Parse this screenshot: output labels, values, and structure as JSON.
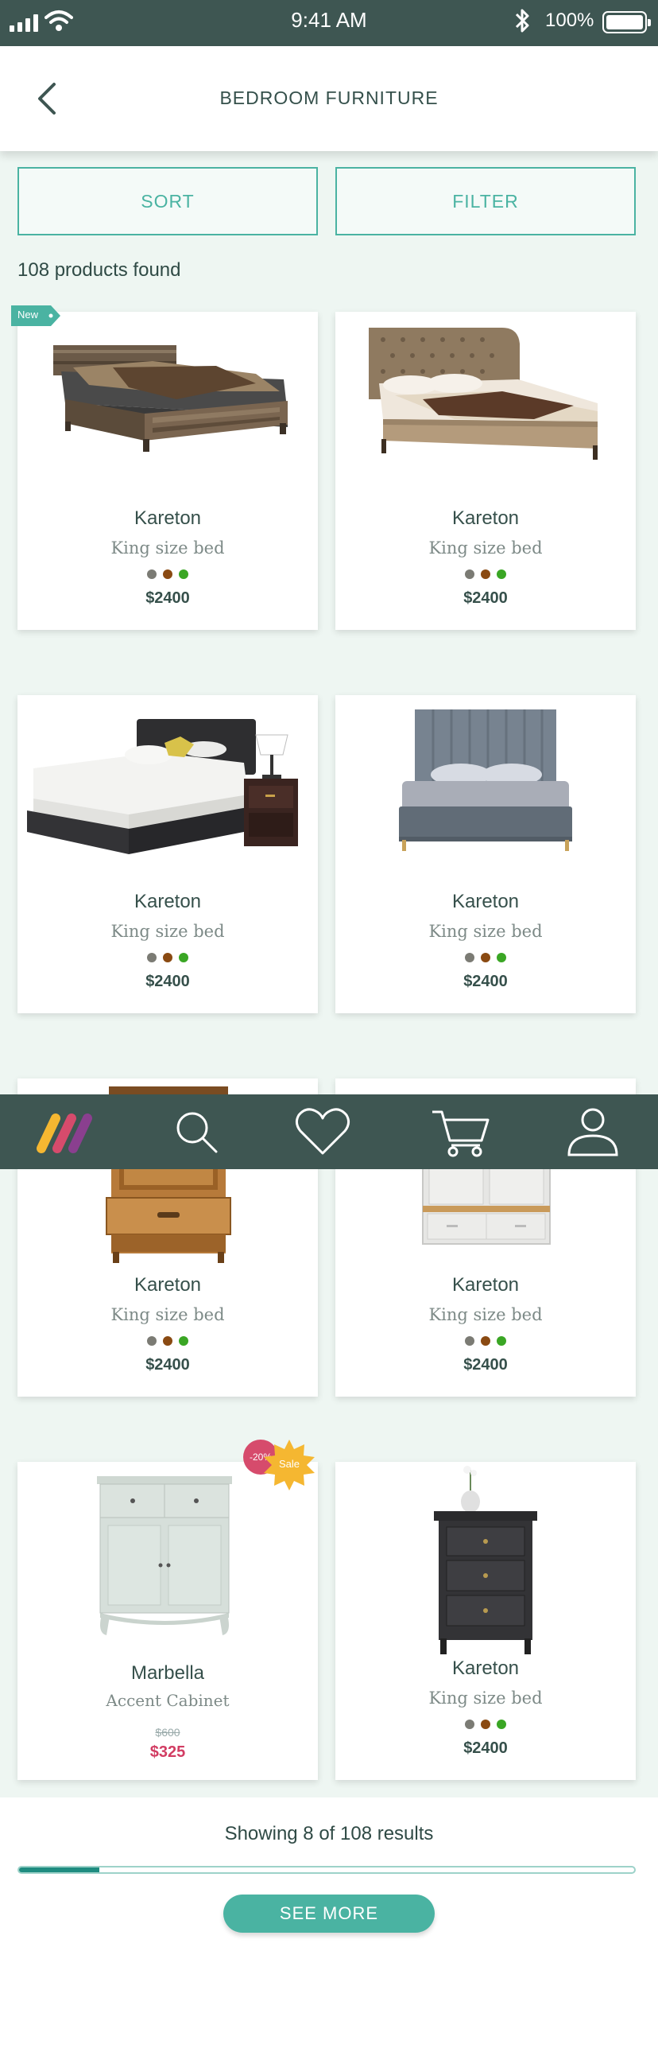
{
  "status_bar": {
    "time": "9:41 AM",
    "battery": "100%"
  },
  "header": {
    "title": "BEDROOM FURNITURE",
    "back_icon": "chevron-left-icon"
  },
  "controls": {
    "sort_label": "SORT",
    "filter_label": "FILTER"
  },
  "results": {
    "count_text": "108 products found",
    "showing_text": "Showing 8 of 108 results",
    "progress": 0.13,
    "see_more": "SEE MORE"
  },
  "colors": {
    "accent": "#4ab3a2",
    "nav_bg": "#3e5652",
    "sale": "#d23d63",
    "dot_gray": "#7b7b74",
    "dot_brown": "#8a4a12",
    "dot_green": "#3aa624"
  },
  "products": [
    {
      "name": "Kareton",
      "desc": "King size bed",
      "price": "$2400",
      "tag": "New",
      "image": "rustic-bed"
    },
    {
      "name": "Kareton",
      "desc": "King size bed",
      "price": "$2400",
      "image": "tufted-bed"
    },
    {
      "name": "Kareton",
      "desc": "King size bed",
      "price": "$2400",
      "image": "platform-bed"
    },
    {
      "name": "Kareton",
      "desc": "King size bed",
      "price": "$2400",
      "image": "gray-panel-bed"
    },
    {
      "name": "Kareton",
      "desc": "King size bed",
      "price": "$2400",
      "image": "wood-armoire"
    },
    {
      "name": "Kareton",
      "desc": "King size bed",
      "price": "$2400",
      "image": "white-wardrobe"
    },
    {
      "name": "Marbella",
      "desc": "Accent Cabinet",
      "old_price": "$600",
      "price": "$325",
      "discount": "-20%",
      "sale_label": "Sale",
      "image": "accent-cabinet"
    },
    {
      "name": "Kareton",
      "desc": "King size bed",
      "price": "$2400",
      "image": "black-nightstand"
    }
  ],
  "nav": [
    {
      "icon": "logo-icon"
    },
    {
      "icon": "search-icon"
    },
    {
      "icon": "heart-icon"
    },
    {
      "icon": "cart-icon"
    },
    {
      "icon": "user-icon"
    }
  ]
}
